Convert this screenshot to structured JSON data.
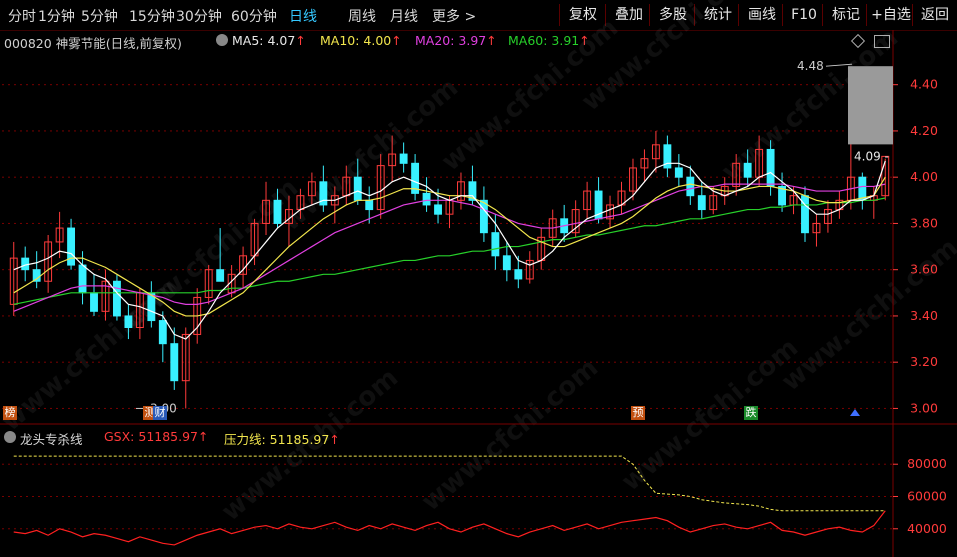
{
  "toolbar": {
    "period_tabs": [
      "分时",
      "1分钟",
      "5分钟",
      "15分钟",
      "30分钟",
      "60分钟",
      "日线",
      "周线",
      "月线",
      "更多 >"
    ],
    "active_tab": "日线",
    "buttons": [
      "复权",
      "叠加",
      "多股",
      "统计",
      "画线",
      "F10",
      "标记",
      "+自选",
      "返回"
    ]
  },
  "stock": {
    "title": "000820 神雾节能(日线,前复权)",
    "ma5_label": "MA5: 4.07",
    "ma10_label": "MA10: 4.00",
    "ma20_label": "MA20: 3.97",
    "ma60_label": "MA60: 3.91",
    "arrow": "↑"
  },
  "colors": {
    "up": "#ff3b3b",
    "down": "#38f0ff",
    "ma5": "#ffffff",
    "ma10": "#f2e64d",
    "ma20": "#e040e0",
    "ma60": "#27d02a",
    "grid": "#7a0000",
    "active_tab": "#35c8ff"
  },
  "price_axis": {
    "ticks": [
      "4.40",
      "4.20",
      "4.00",
      "3.80",
      "3.60",
      "3.40",
      "3.20",
      "3.00"
    ],
    "max_label": "4.48",
    "min_label": "3.00",
    "current_label": "4.09"
  },
  "markers": {
    "bang": "榜",
    "cai": "财",
    "yu": "预",
    "die": "跌",
    "small": "测"
  },
  "indicator": {
    "name": "龙头专杀线",
    "gsx_label": "GSX: 51185.97",
    "pressure_label": "压力线: 51185.97",
    "arrow": "↑",
    "ticks": [
      "80000",
      "60000",
      "40000"
    ]
  },
  "watermark_text": "www.cfchi.com",
  "chart_data": {
    "type": "candlestick",
    "ylim": [
      2.95,
      4.55
    ],
    "candles": [
      [
        3.45,
        3.72,
        3.4,
        3.65
      ],
      [
        3.65,
        3.7,
        3.55,
        3.6
      ],
      [
        3.6,
        3.68,
        3.52,
        3.55
      ],
      [
        3.55,
        3.75,
        3.5,
        3.72
      ],
      [
        3.72,
        3.85,
        3.65,
        3.78
      ],
      [
        3.78,
        3.82,
        3.6,
        3.62
      ],
      [
        3.62,
        3.68,
        3.45,
        3.5
      ],
      [
        3.5,
        3.58,
        3.4,
        3.42
      ],
      [
        3.42,
        3.6,
        3.38,
        3.55
      ],
      [
        3.55,
        3.58,
        3.38,
        3.4
      ],
      [
        3.4,
        3.45,
        3.3,
        3.35
      ],
      [
        3.35,
        3.52,
        3.3,
        3.5
      ],
      [
        3.5,
        3.55,
        3.35,
        3.38
      ],
      [
        3.38,
        3.42,
        3.2,
        3.28
      ],
      [
        3.28,
        3.35,
        3.08,
        3.12
      ],
      [
        3.12,
        3.35,
        3.0,
        3.32
      ],
      [
        3.32,
        3.52,
        3.28,
        3.48
      ],
      [
        3.48,
        3.62,
        3.45,
        3.6
      ],
      [
        3.6,
        3.78,
        3.55,
        3.55
      ],
      [
        3.5,
        3.62,
        3.48,
        3.58
      ],
      [
        3.58,
        3.7,
        3.52,
        3.66
      ],
      [
        3.66,
        3.82,
        3.62,
        3.8
      ],
      [
        3.8,
        3.98,
        3.75,
        3.9
      ],
      [
        3.9,
        3.95,
        3.78,
        3.8
      ],
      [
        3.8,
        3.92,
        3.7,
        3.86
      ],
      [
        3.86,
        3.95,
        3.82,
        3.92
      ],
      [
        3.92,
        4.02,
        3.88,
        3.98
      ],
      [
        3.98,
        4.05,
        3.85,
        3.88
      ],
      [
        3.88,
        3.96,
        3.8,
        3.92
      ],
      [
        3.92,
        4.05,
        3.88,
        4.0
      ],
      [
        4.0,
        4.08,
        3.88,
        3.9
      ],
      [
        3.9,
        3.96,
        3.8,
        3.86
      ],
      [
        3.86,
        4.1,
        3.82,
        4.05
      ],
      [
        4.05,
        4.18,
        3.98,
        4.1
      ],
      [
        4.1,
        4.15,
        4.02,
        4.06
      ],
      [
        4.06,
        4.1,
        3.9,
        3.93
      ],
      [
        3.93,
        4.0,
        3.85,
        3.88
      ],
      [
        3.88,
        3.95,
        3.8,
        3.84
      ],
      [
        3.84,
        3.92,
        3.78,
        3.9
      ],
      [
        3.9,
        4.02,
        3.86,
        3.98
      ],
      [
        3.98,
        4.05,
        3.88,
        3.9
      ],
      [
        3.9,
        3.96,
        3.72,
        3.76
      ],
      [
        3.76,
        3.84,
        3.6,
        3.66
      ],
      [
        3.66,
        3.72,
        3.55,
        3.6
      ],
      [
        3.6,
        3.66,
        3.52,
        3.56
      ],
      [
        3.56,
        3.68,
        3.54,
        3.64
      ],
      [
        3.64,
        3.78,
        3.6,
        3.74
      ],
      [
        3.74,
        3.86,
        3.7,
        3.82
      ],
      [
        3.82,
        3.88,
        3.72,
        3.76
      ],
      [
        3.76,
        3.9,
        3.74,
        3.86
      ],
      [
        3.86,
        3.98,
        3.82,
        3.94
      ],
      [
        3.94,
        4.0,
        3.8,
        3.82
      ],
      [
        3.82,
        3.92,
        3.78,
        3.88
      ],
      [
        3.88,
        3.98,
        3.84,
        3.94
      ],
      [
        3.94,
        4.08,
        3.9,
        4.04
      ],
      [
        4.04,
        4.12,
        3.98,
        4.08
      ],
      [
        4.08,
        4.2,
        4.02,
        4.14
      ],
      [
        4.14,
        4.18,
        4.0,
        4.04
      ],
      [
        4.04,
        4.1,
        3.96,
        4.0
      ],
      [
        4.0,
        4.05,
        3.88,
        3.92
      ],
      [
        3.92,
        3.98,
        3.82,
        3.86
      ],
      [
        3.86,
        3.96,
        3.84,
        3.92
      ],
      [
        3.92,
        4.0,
        3.88,
        3.96
      ],
      [
        3.96,
        4.1,
        3.92,
        4.06
      ],
      [
        4.06,
        4.12,
        3.96,
        4.0
      ],
      [
        4.0,
        4.18,
        3.96,
        4.12
      ],
      [
        4.12,
        4.16,
        3.92,
        3.96
      ],
      [
        3.96,
        4.02,
        3.85,
        3.88
      ],
      [
        3.88,
        3.96,
        3.84,
        3.92
      ],
      [
        3.92,
        3.96,
        3.72,
        3.76
      ],
      [
        3.76,
        3.84,
        3.7,
        3.8
      ],
      [
        3.8,
        3.9,
        3.76,
        3.86
      ],
      [
        3.86,
        3.94,
        3.82,
        3.9
      ],
      [
        3.9,
        4.15,
        3.86,
        4.0
      ],
      [
        4.0,
        4.02,
        3.86,
        3.9
      ],
      [
        3.9,
        3.96,
        3.82,
        3.92
      ],
      [
        3.92,
        4.08,
        3.9,
        4.09
      ]
    ],
    "ma5_points": [
      3.6,
      3.62,
      3.63,
      3.65,
      3.68,
      3.67,
      3.62,
      3.58,
      3.56,
      3.5,
      3.45,
      3.44,
      3.42,
      3.4,
      3.32,
      3.3,
      3.35,
      3.42,
      3.5,
      3.55,
      3.6,
      3.66,
      3.72,
      3.78,
      3.82,
      3.86,
      3.88,
      3.9,
      3.9,
      3.92,
      3.94,
      3.92,
      3.94,
      3.98,
      4.0,
      3.98,
      3.96,
      3.92,
      3.9,
      3.92,
      3.92,
      3.86,
      3.8,
      3.72,
      3.64,
      3.62,
      3.64,
      3.68,
      3.74,
      3.78,
      3.82,
      3.84,
      3.86,
      3.88,
      3.92,
      3.98,
      4.04,
      4.06,
      4.06,
      4.04,
      3.98,
      3.94,
      3.92,
      3.94,
      3.96,
      4.0,
      4.02,
      3.98,
      3.94,
      3.88,
      3.84,
      3.84,
      3.86,
      3.9,
      3.9,
      3.92,
      4.07
    ],
    "ma10_points": [
      3.5,
      3.53,
      3.56,
      3.6,
      3.63,
      3.65,
      3.65,
      3.63,
      3.61,
      3.58,
      3.55,
      3.52,
      3.49,
      3.46,
      3.42,
      3.4,
      3.4,
      3.41,
      3.44,
      3.47,
      3.5,
      3.55,
      3.6,
      3.65,
      3.7,
      3.74,
      3.78,
      3.82,
      3.85,
      3.88,
      3.9,
      3.9,
      3.91,
      3.93,
      3.95,
      3.95,
      3.94,
      3.93,
      3.92,
      3.92,
      3.91,
      3.89,
      3.86,
      3.82,
      3.78,
      3.74,
      3.72,
      3.7,
      3.7,
      3.72,
      3.74,
      3.76,
      3.78,
      3.8,
      3.83,
      3.87,
      3.91,
      3.94,
      3.96,
      3.97,
      3.96,
      3.95,
      3.94,
      3.94,
      3.95,
      3.96,
      3.96,
      3.95,
      3.94,
      3.92,
      3.9,
      3.89,
      3.89,
      3.9,
      3.91,
      3.92,
      4.0
    ],
    "ma20_points": [
      3.42,
      3.44,
      3.46,
      3.48,
      3.5,
      3.52,
      3.53,
      3.53,
      3.53,
      3.52,
      3.51,
      3.5,
      3.49,
      3.48,
      3.46,
      3.45,
      3.45,
      3.46,
      3.48,
      3.5,
      3.52,
      3.55,
      3.58,
      3.61,
      3.64,
      3.67,
      3.7,
      3.73,
      3.76,
      3.78,
      3.8,
      3.82,
      3.84,
      3.86,
      3.88,
      3.89,
      3.9,
      3.9,
      3.9,
      3.89,
      3.88,
      3.86,
      3.84,
      3.82,
      3.8,
      3.79,
      3.78,
      3.78,
      3.79,
      3.8,
      3.81,
      3.82,
      3.83,
      3.84,
      3.86,
      3.88,
      3.9,
      3.92,
      3.94,
      3.95,
      3.96,
      3.96,
      3.97,
      3.97,
      3.97,
      3.97,
      3.97,
      3.97,
      3.96,
      3.95,
      3.94,
      3.94,
      3.94,
      3.95,
      3.96,
      3.96,
      3.97
    ],
    "ma60_points": [
      3.45,
      3.46,
      3.47,
      3.48,
      3.49,
      3.5,
      3.5,
      3.5,
      3.5,
      3.5,
      3.5,
      3.5,
      3.5,
      3.5,
      3.5,
      3.5,
      3.5,
      3.51,
      3.51,
      3.52,
      3.52,
      3.53,
      3.54,
      3.55,
      3.55,
      3.56,
      3.57,
      3.58,
      3.58,
      3.59,
      3.6,
      3.61,
      3.62,
      3.63,
      3.64,
      3.64,
      3.65,
      3.66,
      3.66,
      3.67,
      3.68,
      3.68,
      3.69,
      3.7,
      3.7,
      3.71,
      3.72,
      3.73,
      3.73,
      3.74,
      3.75,
      3.75,
      3.76,
      3.77,
      3.78,
      3.79,
      3.79,
      3.8,
      3.81,
      3.82,
      3.82,
      3.83,
      3.84,
      3.85,
      3.86,
      3.86,
      3.87,
      3.87,
      3.88,
      3.88,
      3.88,
      3.89,
      3.89,
      3.89,
      3.9,
      3.9,
      3.91
    ],
    "indicator_ylim": [
      25000,
      95000
    ],
    "pressure_line": [
      85000,
      85000,
      85000,
      85000,
      85000,
      85000,
      85000,
      85000,
      85000,
      85000,
      85000,
      85000,
      85000,
      85000,
      85000,
      85000,
      85000,
      85000,
      85000,
      85000,
      85000,
      85000,
      85000,
      85000,
      85000,
      85000,
      85000,
      85000,
      85000,
      85000,
      85000,
      85000,
      85000,
      85000,
      85000,
      85000,
      85000,
      85000,
      85000,
      85000,
      85000,
      85000,
      85000,
      85000,
      85000,
      85000,
      85000,
      85000,
      85000,
      85000,
      85000,
      85000,
      85000,
      85000,
      80000,
      70000,
      62000,
      61500,
      61000,
      60000,
      58000,
      57000,
      56000,
      55500,
      55000,
      54000,
      52000,
      51185.97,
      51185.97,
      51185.97,
      51185.97,
      51185.97,
      51185.97,
      51185.97,
      51185.97,
      51185.97,
      51185.97
    ],
    "gsx_line": [
      38000,
      37000,
      39000,
      36000,
      40000,
      38000,
      35000,
      37000,
      36000,
      34000,
      32000,
      35000,
      33000,
      31000,
      30000,
      33000,
      36000,
      38000,
      40000,
      37000,
      39000,
      41000,
      42000,
      40000,
      43000,
      41000,
      40000,
      42000,
      44000,
      41000,
      39000,
      42000,
      40000,
      43000,
      41000,
      39000,
      42000,
      44000,
      40000,
      38000,
      41000,
      43000,
      40000,
      37000,
      35000,
      38000,
      40000,
      42000,
      39000,
      41000,
      43000,
      40000,
      42000,
      44000,
      45000,
      46000,
      47000,
      45000,
      41000,
      38000,
      40000,
      42000,
      43000,
      41000,
      40000,
      42000,
      44000,
      39000,
      38000,
      36000,
      38000,
      40000,
      41000,
      39000,
      38000,
      42000,
      51185.97
    ]
  }
}
